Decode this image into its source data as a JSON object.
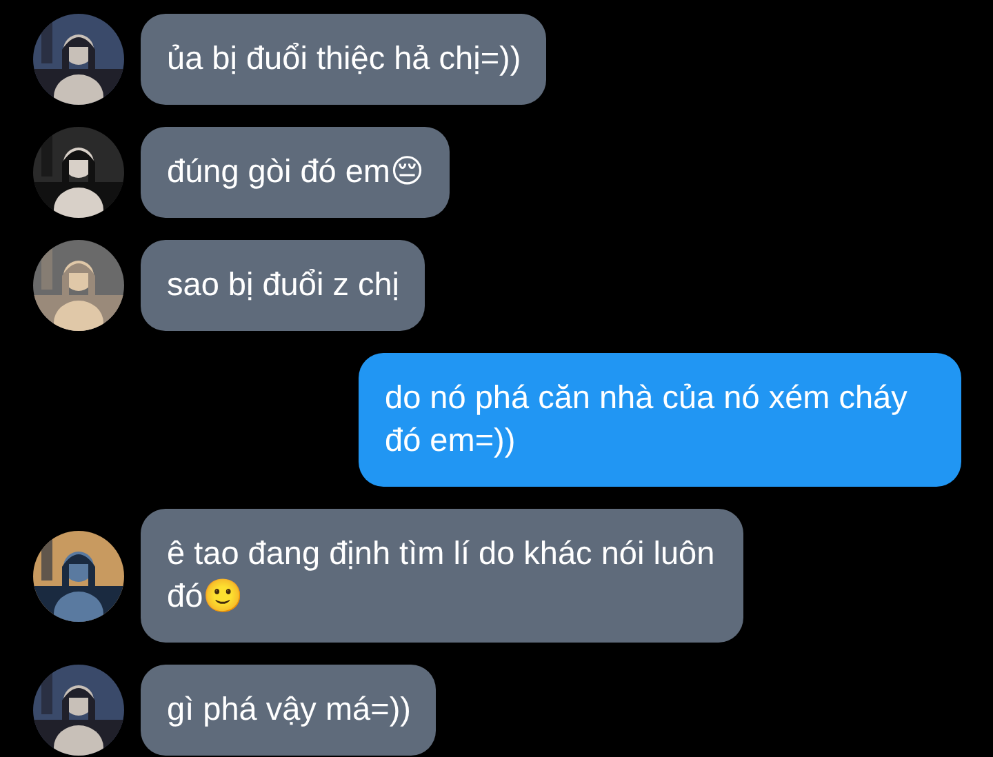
{
  "messages": [
    {
      "kind": "incoming",
      "text": "ủa bị đuổi thiệc hả chị=))"
    },
    {
      "kind": "incoming",
      "text": "đúng gòi đó em😔"
    },
    {
      "kind": "incoming",
      "text": "sao bị đuổi z chị"
    },
    {
      "kind": "outgoing",
      "text": "do nó phá căn nhà của nó xém cháy đó em=))"
    },
    {
      "kind": "incoming",
      "text": "ê tao đang định tìm lí do khác nói luôn đó🙂"
    },
    {
      "kind": "incoming",
      "text": "gì phá vậy má=))"
    }
  ]
}
